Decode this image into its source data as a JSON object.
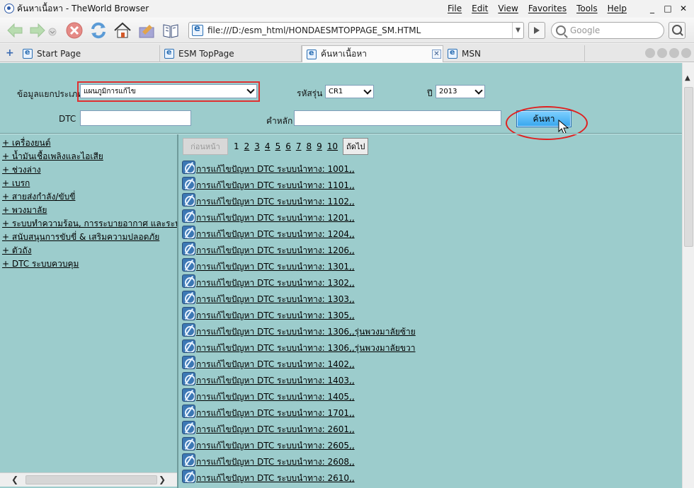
{
  "window": {
    "title": "ค้นหาเนื้อหา - TheWorld Browser"
  },
  "menu": [
    "File",
    "Edit",
    "View",
    "Favorites",
    "Tools",
    "Help"
  ],
  "window_controls": [
    "_",
    "□",
    "✕"
  ],
  "address": {
    "url": "file:///D:/esm_html/HONDAESMTOPPAGE_SM.HTML"
  },
  "search_box": {
    "placeholder": "Google"
  },
  "tabs": [
    {
      "label": "Start Page"
    },
    {
      "label": "ESM TopPage"
    },
    {
      "label": "ค้นหาเนื้อหา"
    },
    {
      "label": "MSN"
    }
  ],
  "form": {
    "category_label": "ข้อมูลแยกประเภท",
    "category_value": "แผนภูมิการแก้ไข",
    "model_label": "รหัสรุ่น",
    "model_value": "CR1",
    "year_label": "ปี",
    "year_value": "2013",
    "dtc_label": "DTC",
    "keyword_label": "คำหลัก",
    "search_button": "ค้นหา"
  },
  "categories": [
    "+ เครื่องยนต์",
    "+ น้ำมันเชื้อเพลิงและไอเสีย",
    "+ ช่วงล่าง",
    "+ เบรก",
    "+ สายส่งกำลัง/ขับขี่",
    "+ พวงมาลัย",
    "+ ระบบทำความร้อน, การระบายอากาศ และระบบปรับ",
    "+ สนับสนุนการขับขี่ & เสริมความปลอดภัย",
    "+ ตัวถัง",
    "+ DTC ระบบควบคุม"
  ],
  "pager": {
    "prev": "ก่อนหน้า",
    "pages": [
      "1",
      "2",
      "3",
      "4",
      "5",
      "6",
      "7",
      "8",
      "9",
      "10"
    ],
    "current": "1",
    "next": "ถัดไป"
  },
  "results": [
    "การแก้ไขปัญหา DTC ระบบนำทาง: 1001,,",
    "การแก้ไขปัญหา DTC ระบบนำทาง: 1101,,",
    "การแก้ไขปัญหา DTC ระบบนำทาง: 1102,,",
    "การแก้ไขปัญหา DTC ระบบนำทาง: 1201,,",
    "การแก้ไขปัญหา DTC ระบบนำทาง: 1204,,",
    "การแก้ไขปัญหา DTC ระบบนำทาง: 1206,,",
    "การแก้ไขปัญหา DTC ระบบนำทาง: 1301,,",
    "การแก้ไขปัญหา DTC ระบบนำทาง: 1302,,",
    "การแก้ไขปัญหา DTC ระบบนำทาง: 1303,,",
    "การแก้ไขปัญหา DTC ระบบนำทาง: 1305,,",
    "การแก้ไขปัญหา DTC ระบบนำทาง: 1306,,รุ่นพวงมาลัยซ้าย",
    "การแก้ไขปัญหา DTC ระบบนำทาง: 1306,,รุ่นพวงมาลัยขวา",
    "การแก้ไขปัญหา DTC ระบบนำทาง: 1402,,",
    "การแก้ไขปัญหา DTC ระบบนำทาง: 1403,,",
    "การแก้ไขปัญหา DTC ระบบนำทาง: 1405,,",
    "การแก้ไขปัญหา DTC ระบบนำทาง: 1701,,",
    "การแก้ไขปัญหา DTC ระบบนำทาง: 2601,,",
    "การแก้ไขปัญหา DTC ระบบนำทาง: 2605,,",
    "การแก้ไขปัญหา DTC ระบบนำทาง: 2608,,",
    "การแก้ไขปัญหา DTC ระบบนำทาง: 2610,,"
  ],
  "colors": {
    "content_bg": "#9ccccc",
    "highlight_red": "#e03030",
    "search_button_blue": "#36a6ee"
  }
}
